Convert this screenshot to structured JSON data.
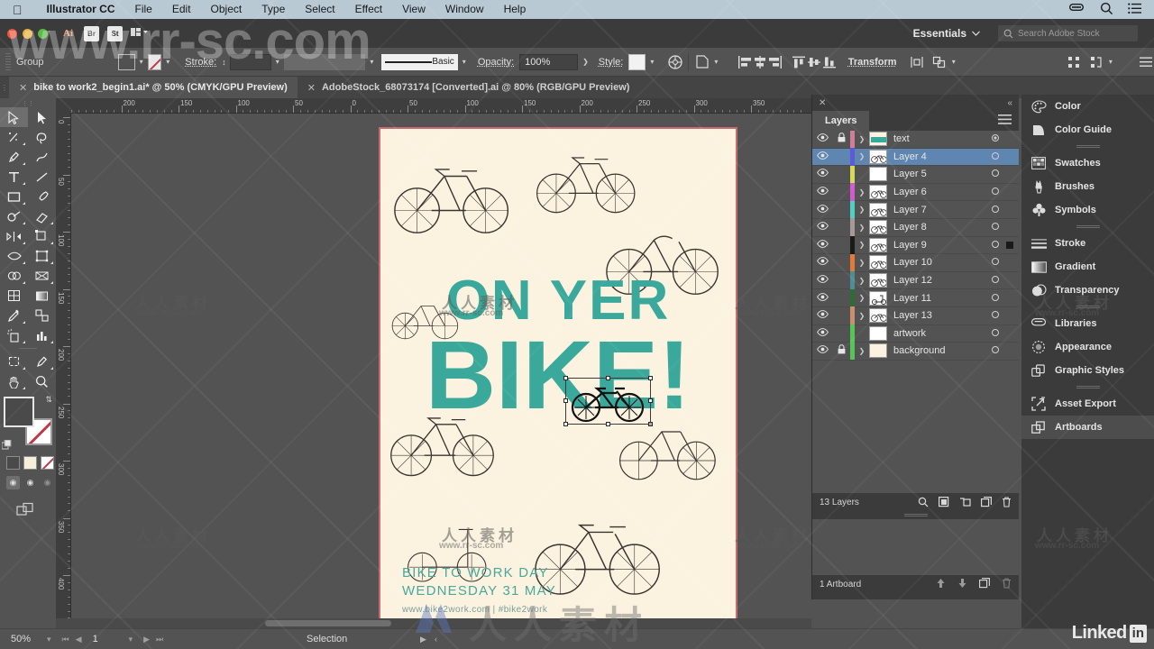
{
  "menubar": {
    "apple_icon": "apple-icon",
    "app_name": "Illustrator CC",
    "items": [
      "File",
      "Edit",
      "Object",
      "Type",
      "Select",
      "Effect",
      "View",
      "Window",
      "Help"
    ],
    "right_icons": [
      "creative-cloud-icon",
      "search-icon",
      "list-icon"
    ]
  },
  "appbar": {
    "icons": [
      "Ai",
      "Br",
      "St"
    ],
    "workspace": "Essentials",
    "search_placeholder": "Search Adobe Stock"
  },
  "control_bar": {
    "selection_label": "Group",
    "stroke_label": "Stroke:",
    "stroke_weight": "",
    "brush_label": "Basic",
    "opacity_label": "Opacity:",
    "opacity_value": "100%",
    "style_label": "Style:",
    "transform_label": "Transform",
    "icons": [
      "fill-swatch",
      "stroke-swatch",
      "stroke-weight-field",
      "brush-definition",
      "opacity-field",
      "style-swatch",
      "recolor-artwork-icon",
      "document-setup-icon",
      "align-left-icon",
      "align-center-h-icon",
      "align-right-icon",
      "align-top-icon",
      "align-middle-icon",
      "align-bottom-icon",
      "transform-icon",
      "isolate-icon",
      "arrange-icon",
      "distribute-icon",
      "settings-icon",
      "list-icon"
    ]
  },
  "tabs": [
    {
      "title": "bike to work2_begin1.ai* @ 50% (CMYK/GPU Preview)",
      "active": true
    },
    {
      "title": "AdobeStock_68073174 [Converted].ai @ 80% (RGB/GPU Preview)",
      "active": false
    }
  ],
  "tools": {
    "rows": [
      [
        "selection-tool",
        "direct-selection-tool"
      ],
      [
        "magic-wand-tool",
        "lasso-tool"
      ],
      [
        "pen-tool",
        "curvature-tool"
      ],
      [
        "type-tool",
        "line-segment-tool"
      ],
      [
        "rectangle-tool",
        "paintbrush-tool"
      ],
      [
        "shaper-tool",
        "eraser-tool"
      ],
      [
        "rotate-tool",
        "scale-tool"
      ],
      [
        "width-tool",
        "free-transform-tool"
      ],
      [
        "shape-builder-tool",
        "perspective-grid-tool"
      ],
      [
        "mesh-tool",
        "gradient-tool"
      ],
      [
        "eyedropper-tool",
        "blend-tool"
      ],
      [
        "symbol-sprayer-tool",
        "column-graph-tool"
      ],
      [
        "artboard-tool",
        "slice-tool"
      ],
      [
        "hand-tool",
        "zoom-tool"
      ]
    ],
    "fill_color": "#4a4a4a",
    "stroke_color": "#ffffff",
    "mini_swatches": [
      "color-swatch",
      "gradient-swatch",
      "none-swatch"
    ],
    "screen_modes": [
      "normal-screen-mode",
      "full-screen-menu-mode",
      "full-screen-mode"
    ]
  },
  "rulers": {
    "horizontal_labels": [
      "0",
      "200",
      "150",
      "100",
      "50",
      "0",
      "50",
      "100",
      "150",
      "200",
      "250",
      "300",
      "350"
    ],
    "vertical_labels": [
      "0",
      "50",
      "100",
      "150",
      "200",
      "250",
      "300",
      "350",
      "400"
    ]
  },
  "artboard": {
    "poster": {
      "headline_top": "ON YER",
      "headline_main": "BIKE!",
      "footer_line1": "BIKE TO WORK DAY",
      "footer_line2": "WEDNESDAY 31 MAY",
      "footer_line3": "www.bike2work.com | #bike2work",
      "teal": "#3aa99b",
      "paper": "#fbf3e0",
      "border": "#c86a72"
    }
  },
  "layers_panel": {
    "title": "Layers",
    "close_icon": "close-icon",
    "collapse_icon": "collapse-icon",
    "menu_icon": "panel-menu-icon",
    "rows": [
      {
        "name": "text",
        "visible": true,
        "locked": true,
        "color": "#d07f9b",
        "selected": false,
        "has_arrow": true,
        "thumb": "teal",
        "target_filled": true,
        "square": false
      },
      {
        "name": "Layer 4",
        "visible": true,
        "locked": false,
        "color": "#5b5bd6",
        "selected": true,
        "has_arrow": true,
        "thumb": "bikes",
        "target_filled": false,
        "square": false
      },
      {
        "name": "Layer 5",
        "visible": true,
        "locked": false,
        "color": "#d8d85a",
        "selected": false,
        "has_arrow": false,
        "thumb": "blank",
        "target_filled": false,
        "square": false
      },
      {
        "name": "Layer 6",
        "visible": true,
        "locked": false,
        "color": "#cf5bcf",
        "selected": false,
        "has_arrow": true,
        "thumb": "bikes",
        "target_filled": false,
        "square": false
      },
      {
        "name": "Layer 7",
        "visible": true,
        "locked": false,
        "color": "#4fd0c0",
        "selected": false,
        "has_arrow": true,
        "thumb": "bikes",
        "target_filled": false,
        "square": false
      },
      {
        "name": "Layer 8",
        "visible": true,
        "locked": false,
        "color": "#a89898",
        "selected": false,
        "has_arrow": true,
        "thumb": "bikes",
        "target_filled": false,
        "square": false
      },
      {
        "name": "Layer 9",
        "visible": true,
        "locked": false,
        "color": "#1a1a1a",
        "selected": false,
        "has_arrow": true,
        "thumb": "bikes",
        "target_filled": false,
        "square": true
      },
      {
        "name": "Layer 10",
        "visible": true,
        "locked": false,
        "color": "#e07b3a",
        "selected": false,
        "has_arrow": true,
        "thumb": "bikes",
        "target_filled": false,
        "square": false
      },
      {
        "name": "Layer 12",
        "visible": true,
        "locked": false,
        "color": "#4f8d95",
        "selected": false,
        "has_arrow": true,
        "thumb": "bikes",
        "target_filled": false,
        "square": false
      },
      {
        "name": "Layer 11",
        "visible": true,
        "locked": false,
        "color": "#2f6b36",
        "selected": false,
        "has_arrow": true,
        "thumb": "scooter",
        "target_filled": false,
        "square": false
      },
      {
        "name": "Layer 13",
        "visible": true,
        "locked": false,
        "color": "#c99070",
        "selected": false,
        "has_arrow": true,
        "thumb": "bikes",
        "target_filled": false,
        "square": false
      },
      {
        "name": "artwork",
        "visible": true,
        "locked": false,
        "color": "#56c456",
        "selected": false,
        "has_arrow": false,
        "thumb": "blank",
        "target_filled": false,
        "square": false
      },
      {
        "name": "background",
        "visible": true,
        "locked": true,
        "color": "#56c456",
        "selected": false,
        "has_arrow": true,
        "thumb": "cream",
        "target_filled": false,
        "square": false
      }
    ],
    "footer_count": "13 Layers",
    "footer_icons": [
      "locate-object-icon",
      "make-clipping-mask-icon",
      "create-sublayer-icon",
      "create-new-layer-icon",
      "delete-selection-icon"
    ],
    "artboards_count": "1 Artboard",
    "artboards_icons": [
      "move-up-icon",
      "move-down-icon",
      "new-artboard-icon",
      "delete-artboard-icon"
    ]
  },
  "dock": {
    "groups": [
      [
        {
          "label": "Color",
          "icon": "color-palette-icon"
        },
        {
          "label": "Color Guide",
          "icon": "color-guide-icon"
        }
      ],
      [
        {
          "label": "Swatches",
          "icon": "swatches-icon"
        },
        {
          "label": "Brushes",
          "icon": "brushes-icon"
        },
        {
          "label": "Symbols",
          "icon": "symbols-icon"
        }
      ],
      [
        {
          "label": "Stroke",
          "icon": "stroke-icon"
        },
        {
          "label": "Gradient",
          "icon": "gradient-icon"
        },
        {
          "label": "Transparency",
          "icon": "transparency-icon"
        }
      ],
      [
        {
          "label": "Libraries",
          "icon": "libraries-icon"
        },
        {
          "label": "Appearance",
          "icon": "appearance-icon"
        },
        {
          "label": "Graphic Styles",
          "icon": "graphic-styles-icon"
        }
      ],
      [
        {
          "label": "Asset Export",
          "icon": "asset-export-icon"
        },
        {
          "label": "Artboards",
          "icon": "artboards-icon",
          "active": true
        }
      ]
    ]
  },
  "statusbar": {
    "zoom": "50%",
    "page": "1",
    "tool_status": "Selection"
  },
  "watermarks": {
    "top": "www.rr-sc.com",
    "site": "www.rr-sc.com",
    "cn": "人人素材",
    "badge": "Linked",
    "badge_suffix": "in"
  }
}
